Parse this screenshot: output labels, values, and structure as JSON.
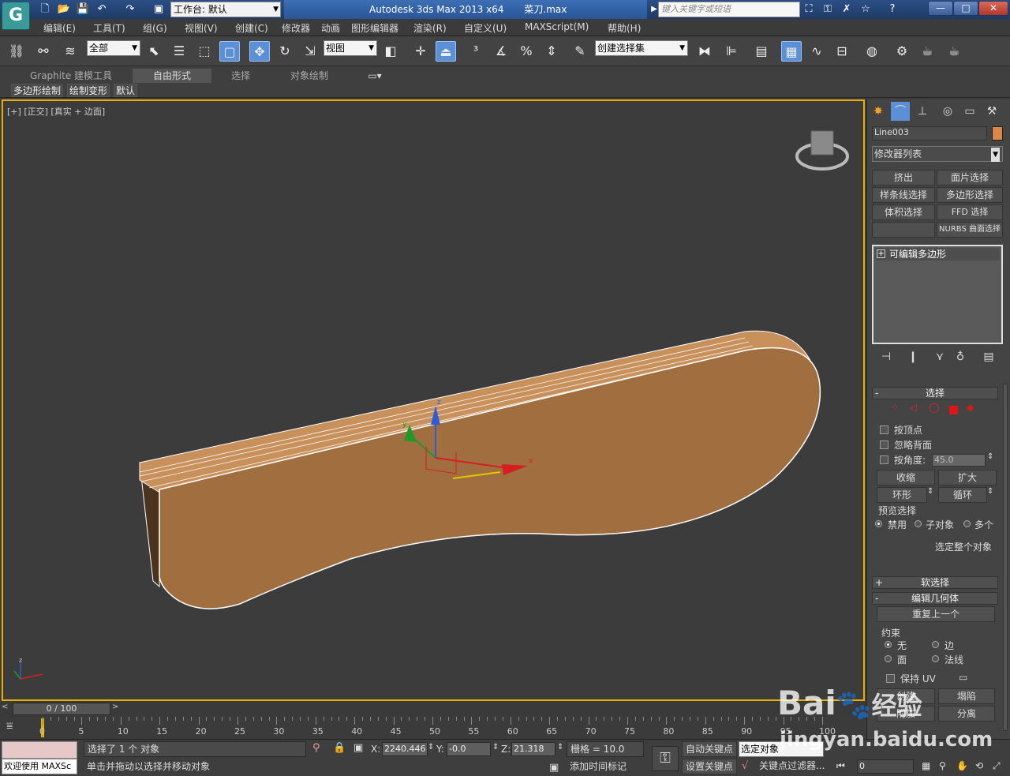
{
  "app": {
    "logo_glyph": "G",
    "title": "Autodesk 3ds Max  2013 x64",
    "file_name": "菜刀.max",
    "workspace_label": "工作台: 默认",
    "search_placeholder": "键入关键字或短语"
  },
  "window_buttons": [
    "—",
    "□",
    "✕"
  ],
  "menu": [
    "编辑(E)",
    "工具(T)",
    "组(G)",
    "视图(V)",
    "创建(C)",
    "修改器",
    "动画",
    "图形编辑器",
    "渲染(R)",
    "自定义(U)",
    "MAXScript(M)",
    "帮助(H)"
  ],
  "toolbar": {
    "selection_filter": "全部",
    "reference_coord": "视图",
    "named_selection": "创建选择集"
  },
  "ribbon": {
    "tabs": [
      "Graphite 建模工具",
      "自由形式",
      "选择",
      "对象绘制"
    ],
    "active_tab": "自由形式",
    "subtabs": [
      "多边形绘制",
      "绘制变形",
      "默认"
    ]
  },
  "viewport": {
    "label_plus": "[+]",
    "label_view": "[正交]",
    "label_shading": "[真实 + 边面]",
    "axis_x": "x",
    "axis_y": "y",
    "axis_z": "z",
    "object_color": "#a06e3f",
    "object_top_color": "#c8915c",
    "border_color": "#e8b000"
  },
  "command_panel": {
    "object_name": "Line003",
    "object_color": "#d9884a",
    "modifier_list": "修改器列表",
    "mod_buttons": [
      "挤出",
      "面片选择",
      "样条线选择",
      "多边形选择",
      "体积选择",
      "FFD 选择",
      "",
      "NURBS 曲面选择"
    ],
    "stack_item": "可编辑多边形",
    "selection": {
      "title": "选择",
      "by_vertex": "按顶点",
      "ignore_backfacing": "忽略背面",
      "by_angle": "按角度:",
      "angle_value": "45.0",
      "shrink": "收缩",
      "grow": "扩大",
      "ring": "环形",
      "loop": "循环",
      "preview_title": "预览选择",
      "preview_off": "禁用",
      "preview_sub": "子对象",
      "preview_multi": "多个",
      "status": "选定整个对象"
    },
    "soft_selection": "软选择",
    "edit_geometry": {
      "title": "编辑几何体",
      "repeat_last": "重复上一个",
      "constraints_title": "约束",
      "none": "无",
      "edge": "边",
      "face": "面",
      "normal": "法线",
      "preserve_uv": "保持 UV",
      "create": "创建",
      "collapse": "塌陷",
      "attach": "附加",
      "detach": "分离"
    }
  },
  "timeline": {
    "frame_label": "0 / 100",
    "ticks": [
      "0",
      "5",
      "10",
      "15",
      "20",
      "25",
      "30",
      "35",
      "40",
      "45",
      "50",
      "55",
      "60",
      "65",
      "70",
      "75",
      "80",
      "85",
      "90",
      "95",
      "100"
    ]
  },
  "status": {
    "maxscript_label": "欢迎使用 MAXSc",
    "selected_text": "选择了 1 个 对象",
    "prompt_text": "单击并拖动以选择并移动对象",
    "x_label": "X:",
    "x_value": "2240.446",
    "y_label": "Y:",
    "y_value": "-0.0",
    "z_label": "Z:",
    "z_value": "21.318",
    "grid": "栅格 = 10.0",
    "add_time_tag": "添加时间标记",
    "auto_key": "自动关键点",
    "key_mode": "选定对象",
    "set_key": "设置关键点",
    "key_filters": "关键点过滤器...",
    "frame_value": "0"
  },
  "watermark": {
    "brand": "Bai",
    "brand2": "经验",
    "url": "jingyan.baidu.com"
  }
}
